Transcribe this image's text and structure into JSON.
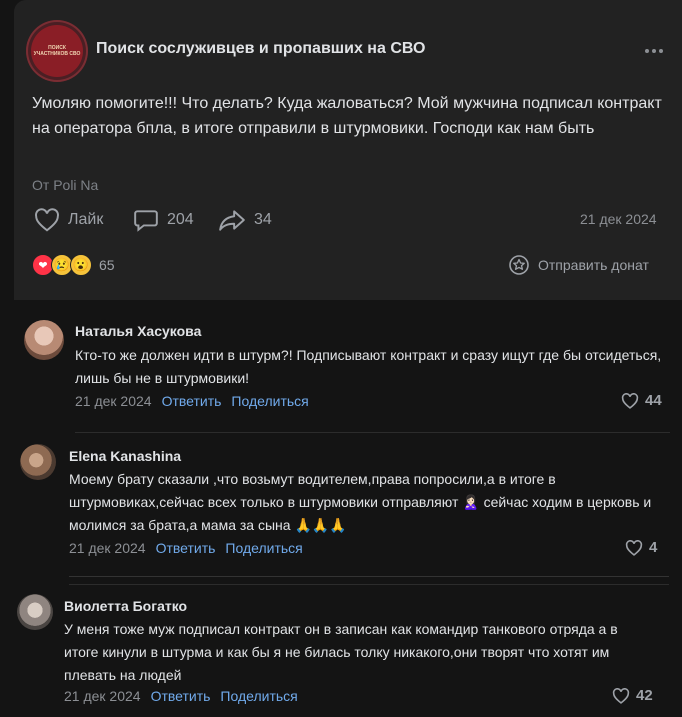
{
  "post": {
    "group_name": "Поиск сослуживцев и пропавших на СВО",
    "avatar_lines": [
      "ПОИСК",
      "УЧАСТНИКОВ СВО"
    ],
    "text": "Умоляю помогите!!! Что делать? Куда жаловаться? Мой мужчина подписал контракт на оператора бпла, в итоге отправили в штурмовики. Господи как нам быть",
    "from": "От Poli Na",
    "like_label": "Лайк",
    "comments_count": "204",
    "shares_count": "34",
    "date": "21 дек 2024",
    "reactions_count": "65",
    "reactions": [
      "❤",
      "😢",
      "😮"
    ],
    "donate_label": "Отправить донат"
  },
  "comments": [
    {
      "name": "Наталья Хасукова",
      "text": "Кто-то же должен идти в штурм?! Подписывают контракт и сразу ищут где бы отсидеться, лишь бы не в штурмовики!",
      "date": "21 дек 2024",
      "reply": "Ответить",
      "share": "Поделиться",
      "likes": "44"
    },
    {
      "name": "Elena Kanashina",
      "text": "Моему брату сказали ,что возьмут водителем,права попросили,а в итоге в штурмовиках,сейчас всех только в штурмовики отправляют 🙎🏻‍♀️ сейчас ходим в церковь и молимся за брата,а мама за сына 🙏🙏🙏",
      "date": "21 дек 2024",
      "reply": "Ответить",
      "share": "Поделиться",
      "likes": "4"
    },
    {
      "name": "Виолетта Богатко",
      "text": "У меня тоже муж подписал контракт он в записан как командир танкового отряда а в итоге кинули в штурма и как бы я не билась толку никакого,они творят что хотят им плевать на людей",
      "date": "21 дек 2024",
      "reply": "Ответить",
      "share": "Поделиться",
      "likes": "42"
    }
  ]
}
